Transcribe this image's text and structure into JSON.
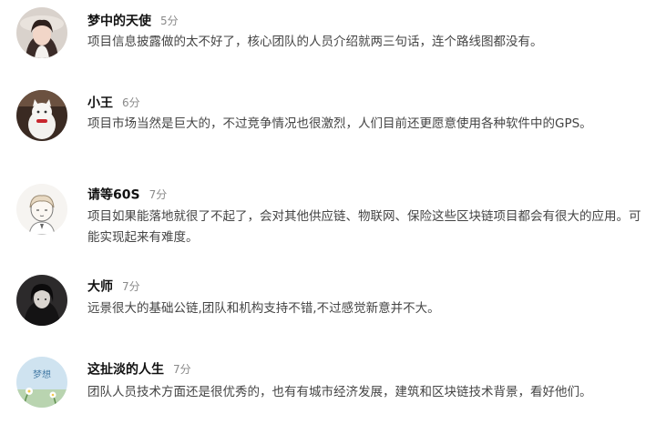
{
  "comments": [
    {
      "name": "梦中的天使",
      "time": "5分",
      "text": "项目信息披露做的太不好了，核心团队的人员介绍就两三句话，连个路线图都没有。",
      "avatar_icon": "girl-photo-icon"
    },
    {
      "name": "小王",
      "time": "6分",
      "text": "项目市场当然是巨大的，不过竞争情况也很激烈，人们目前还更愿意使用各种软件中的GPS。",
      "avatar_icon": "white-cat-icon"
    },
    {
      "name": "请等60S",
      "time": "7分",
      "text": "项目如果能落地就很了不起了，会对其他供应链、物联网、保险这些区块链项目都会有很大的应用。可能实现起来有难度。",
      "avatar_icon": "cartoon-boy-icon"
    },
    {
      "name": "大师",
      "time": "7分",
      "text": "远景很大的基础公链,团队和机构支持不错,不过感觉新意并不大。",
      "avatar_icon": "dark-figure-icon"
    },
    {
      "name": "这扯淡的人生",
      "time": "7分",
      "text": "团队人员技术方面还是很优秀的，也有有城市经济发展，建筑和区块链技术背景，看好他们。",
      "avatar_icon": "dream-flower-icon",
      "avatar_text": "梦想"
    }
  ],
  "colors": {
    "name": "#111111",
    "time": "#8a8a8a",
    "text": "#444444"
  }
}
